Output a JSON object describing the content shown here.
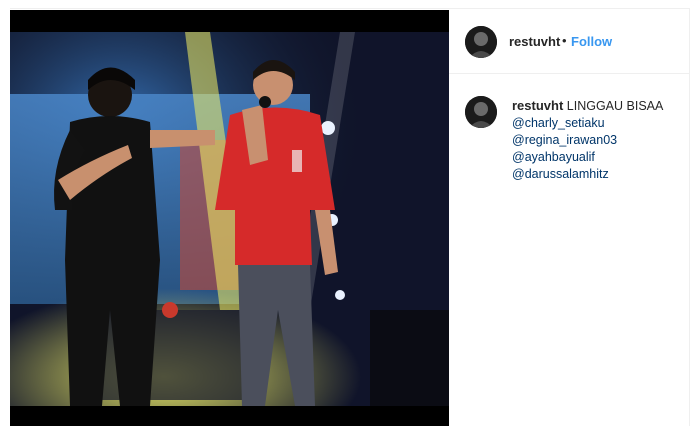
{
  "post": {
    "username": "restuvht",
    "separator": "•",
    "follow_label": "Follow",
    "caption": {
      "username": "restuvht",
      "text": "LINGGAU BISAA",
      "mentions": [
        "@charly_setiaku",
        "@regina_irawan03",
        "@ayahbayualif",
        "@darussalamhitz"
      ]
    }
  },
  "photo": {
    "subject": "concert-stage-photo",
    "colors": {
      "background": "#0d0f1a",
      "stage_light": "#e5e84a",
      "screen": "#3b73b5",
      "red_hoodie": "#d62a2a",
      "black_shirt": "#111111"
    }
  },
  "colors": {
    "link": "#3897f0",
    "mention": "#003569",
    "text": "#262626",
    "divider": "#efefef"
  }
}
